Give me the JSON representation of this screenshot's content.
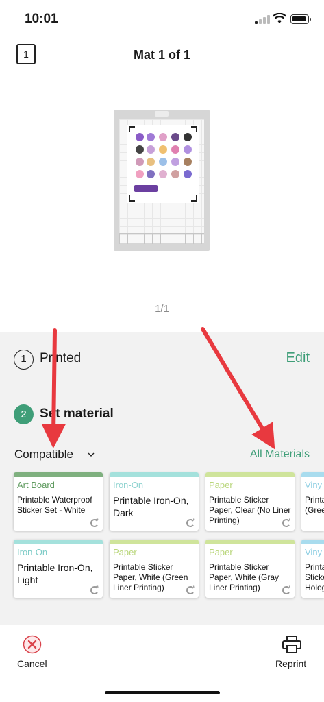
{
  "status_bar": {
    "time": "10:01"
  },
  "header": {
    "mat_icon_label": "1",
    "title": "Mat 1 of 1"
  },
  "preview": {
    "page_indicator": "1/1"
  },
  "steps": {
    "step1": {
      "number": "1",
      "label": "Printed",
      "action": "Edit"
    },
    "step2": {
      "number": "2",
      "label": "Set material"
    }
  },
  "filter": {
    "selected": "Compatible",
    "all_materials_link": "All Materials"
  },
  "materials": [
    {
      "category": "Art Board",
      "name": "Printable Waterproof Sticker Set - White",
      "bar_color": "#7fb07f",
      "cat_color": "#5e9a5e"
    },
    {
      "category": "Iron-On",
      "name": "Printable Iron-On, Dark",
      "bar_color": "#a4e1dc",
      "cat_color": "#8fd3d0"
    },
    {
      "category": "Paper",
      "name": "Printable Sticker Paper, Clear (No Liner Printing)",
      "bar_color": "#cfe49b",
      "cat_color": "#b9d67a"
    },
    {
      "category": "Viny",
      "name": "Printa (Greer",
      "bar_color": "#a9dcee",
      "cat_color": "#8fcfe3"
    },
    {
      "category": "Iron-On",
      "name": "Printable Iron-On, Light",
      "bar_color": "#a4e1dc",
      "cat_color": "#7ccbc6"
    },
    {
      "category": "Paper",
      "name": "Printable Sticker Paper, White (Green Liner Printing)",
      "bar_color": "#cfe49b",
      "cat_color": "#b9d67a"
    },
    {
      "category": "Paper",
      "name": "Printable Sticker Paper, White (Gray Liner Printing)",
      "bar_color": "#cfe49b",
      "cat_color": "#b9d67a"
    },
    {
      "category": "Viny",
      "name": "Printa Sticke Holog",
      "bar_color": "#a9dcee",
      "cat_color": "#8fcfe3"
    }
  ],
  "bottom_bar": {
    "cancel_label": "Cancel",
    "reprint_label": "Reprint"
  },
  "colors": {
    "accent": "#3f9e78",
    "arrow": "#e8393f",
    "cancel": "#d9434b"
  }
}
